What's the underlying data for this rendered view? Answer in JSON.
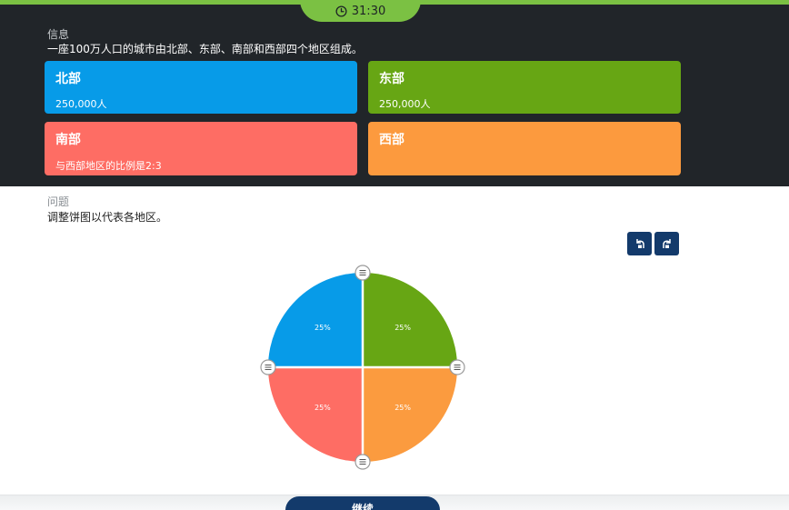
{
  "timer": {
    "text": "31:30"
  },
  "info": {
    "heading": "信息",
    "description": "一座100万人口的城市由北部、东部、南部和西部四个地区组成。",
    "cards": {
      "north": {
        "title": "北部",
        "value": "250,000人",
        "color": "#079be8"
      },
      "east": {
        "title": "东部",
        "value": "250,000人",
        "color": "#67a614"
      },
      "south": {
        "title": "南部",
        "value": "与西部地区的比例是2:3",
        "color": "#fe6d64"
      },
      "west": {
        "title": "西部",
        "value": "",
        "color": "#fc9a3e"
      }
    }
  },
  "question": {
    "heading": "问题",
    "text": "调整饼图以代表各地区。"
  },
  "toolbar": {
    "undo_icon": "undo-icon",
    "redo_icon": "redo-icon"
  },
  "chart_data": {
    "type": "pie",
    "slices": [
      {
        "label": "25%",
        "value": 25,
        "color": "#fb9b3f"
      },
      {
        "label": "25%",
        "value": 25,
        "color": "#fe6d64"
      },
      {
        "label": "25%",
        "value": 25,
        "color": "#079be8"
      },
      {
        "label": "25%",
        "value": 25,
        "color": "#67a614"
      }
    ]
  },
  "continue_button": {
    "label": "继续"
  }
}
